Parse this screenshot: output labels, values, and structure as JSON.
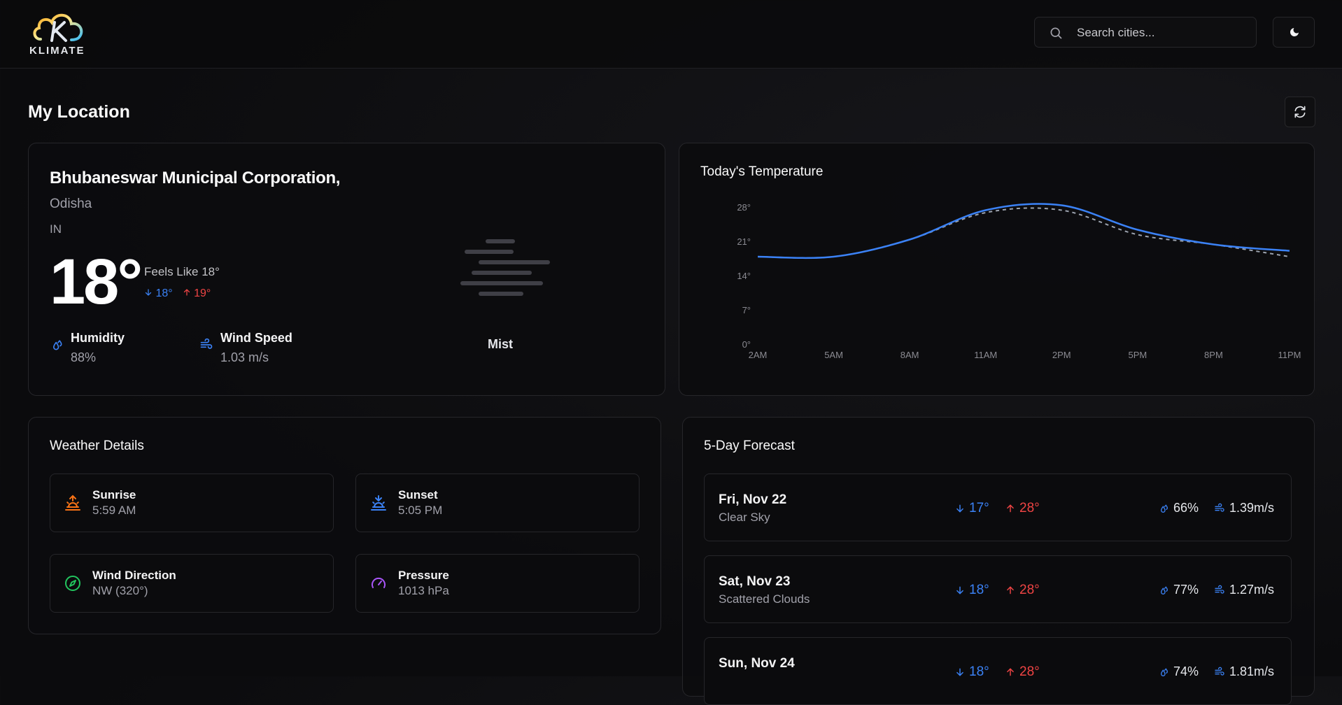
{
  "app": {
    "logo_text": "KLIMATE"
  },
  "search": {
    "placeholder": "Search cities..."
  },
  "section_title": "My Location",
  "current": {
    "city": "Bhubaneswar Municipal Corporation,",
    "state": "Odisha",
    "country": "IN",
    "temp": "18°",
    "feels_like": "Feels Like 18°",
    "min": "18°",
    "max": "19°",
    "humidity_label": "Humidity",
    "humidity_value": "88%",
    "wind_label": "Wind Speed",
    "wind_value": "1.03 m/s",
    "condition": "Mist",
    "condition_icon": "mist-icon"
  },
  "chart_title": "Today's Temperature",
  "chart_data": {
    "type": "line",
    "title": "Today's Temperature",
    "x": [
      "2AM",
      "5AM",
      "8AM",
      "11AM",
      "2PM",
      "5PM",
      "8PM",
      "11PM"
    ],
    "y_ticks": [
      "0°",
      "7°",
      "14°",
      "21°",
      "28°"
    ],
    "ylim": [
      0,
      28
    ],
    "series": [
      {
        "values": [
          18,
          18,
          21.5,
          27.5,
          28.5,
          23.5,
          20.5,
          19.2
        ],
        "color": "#3b82f6",
        "style": "solid"
      },
      {
        "values": [
          18,
          18,
          21.5,
          27,
          27.5,
          22.5,
          20.5,
          18
        ],
        "color": "#9ca3af",
        "style": "dashed"
      }
    ],
    "grid": false
  },
  "details": {
    "title": "Weather Details",
    "items": [
      {
        "label": "Sunrise",
        "value": "5:59 AM",
        "icon": "sunrise-icon",
        "color": "#f97316"
      },
      {
        "label": "Sunset",
        "value": "5:05 PM",
        "icon": "sunset-icon",
        "color": "#3b82f6"
      },
      {
        "label": "Wind Direction",
        "value": "NW (320°)",
        "icon": "compass-icon",
        "color": "#22c55e"
      },
      {
        "label": "Pressure",
        "value": "1013 hPa",
        "icon": "gauge-icon",
        "color": "#a855f7"
      }
    ]
  },
  "forecast": {
    "title": "5-Day Forecast",
    "days": [
      {
        "date": "Fri, Nov 22",
        "desc": "Clear Sky",
        "lo": "17°",
        "hi": "28°",
        "humidity": "66%",
        "wind": "1.39m/s"
      },
      {
        "date": "Sat, Nov 23",
        "desc": "Scattered Clouds",
        "lo": "18°",
        "hi": "28°",
        "humidity": "77%",
        "wind": "1.27m/s"
      },
      {
        "date": "Sun, Nov 24",
        "desc": "",
        "lo": "18°",
        "hi": "28°",
        "humidity": "74%",
        "wind": "1.81m/s"
      }
    ]
  },
  "colors": {
    "accent": "#3b82f6",
    "hot": "#ef4444",
    "background": "#0b0b0d"
  }
}
